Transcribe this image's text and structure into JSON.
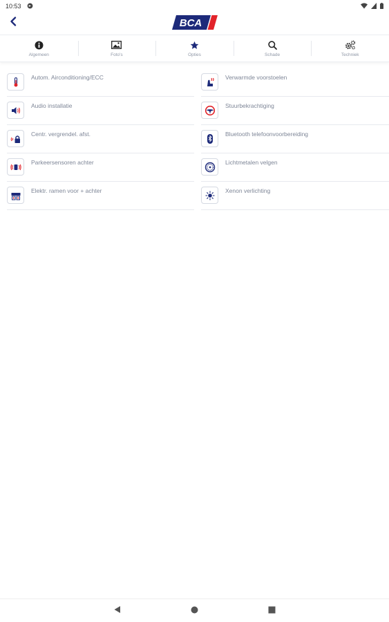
{
  "status_bar": {
    "time": "10:53"
  },
  "header": {
    "logo_text": "BCA",
    "brand_color": "#1d2a7a",
    "accent_color": "#e2232a"
  },
  "tabs": [
    {
      "label": "Algemeen",
      "icon": "info-icon"
    },
    {
      "label": "Foto's",
      "icon": "image-icon"
    },
    {
      "label": "Opties",
      "icon": "star-icon"
    },
    {
      "label": "Schade",
      "icon": "search-icon"
    },
    {
      "label": "Techniek",
      "icon": "gears-icon"
    }
  ],
  "options": [
    {
      "label": "Autom. Airconditioning/ECC",
      "icon": "thermometer-icon"
    },
    {
      "label": "Verwarmde voorstoelen",
      "icon": "heated-seat-icon"
    },
    {
      "label": "Audio installatie",
      "icon": "speaker-icon"
    },
    {
      "label": "Stuurbekrachtiging",
      "icon": "steering-wheel-icon"
    },
    {
      "label": "Centr. vergrendel. afst.",
      "icon": "remote-lock-icon"
    },
    {
      "label": "Bluetooth telefoonvoorbereiding",
      "icon": "bluetooth-icon"
    },
    {
      "label": "Parkeersensoren achter",
      "icon": "parking-sensor-icon"
    },
    {
      "label": "Lichtmetalen velgen",
      "icon": "alloy-wheel-icon"
    },
    {
      "label": "Elektr. ramen voor + achter",
      "icon": "power-windows-icon"
    },
    {
      "label": "Xenon verlichting",
      "icon": "xenon-light-icon"
    }
  ]
}
